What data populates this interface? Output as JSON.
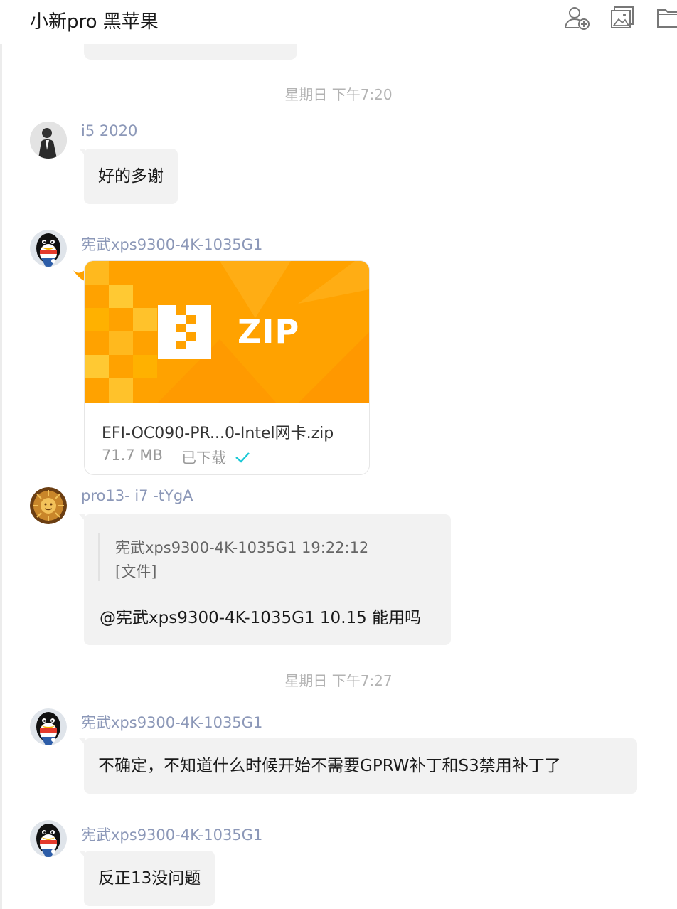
{
  "header": {
    "title": "小新pro 黑苹果",
    "icons": [
      "add-member-icon",
      "image-icon",
      "folder-icon"
    ]
  },
  "timestamps": {
    "t1": "星期日  下午7:20",
    "t2": "星期日  下午7:27"
  },
  "messages": {
    "m1": {
      "sender": "i5 2020",
      "text": "好的多谢"
    },
    "m2": {
      "sender": "宪武xps9300-4K-1035G1",
      "file": {
        "type_label": "ZIP",
        "name": "EFI-OC090-PR...0-Intel网卡.zip",
        "size": "71.7 MB",
        "status": "已下载"
      }
    },
    "m3": {
      "sender": "pro13- i7 -tYgA",
      "quote_header": "宪武xps9300-4K-1035G1 19:22:12",
      "quote_content": "[文件]",
      "text": "@宪武xps9300-4K-1035G1 10.15 能用吗"
    },
    "m4": {
      "sender": "宪武xps9300-4K-1035G1",
      "text": "不确定，不知道什么时候开始不需要GPRW补丁和S3禁用补丁了"
    },
    "m5": {
      "sender": "宪武xps9300-4K-1035G1",
      "text": "反正13没问题"
    }
  },
  "colors": {
    "sender": "#8c98b8",
    "bubble": "#f2f2f2",
    "zip_orange": "#ffa200",
    "check": "#19c8d6"
  }
}
